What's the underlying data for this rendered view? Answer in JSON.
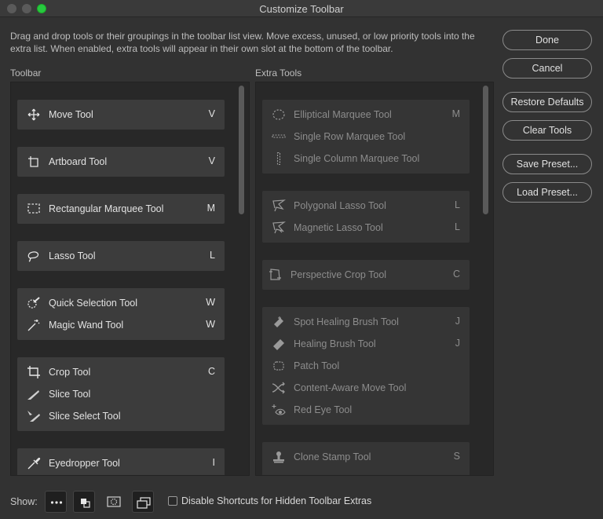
{
  "window": {
    "title": "Customize Toolbar"
  },
  "instructions": "Drag and drop tools or their groupings in the toolbar list view. Move excess, unused, or low priority tools into the extra list. When enabled, extra tools will appear in their own slot at the bottom of the toolbar.",
  "labels": {
    "toolbar": "Toolbar",
    "extra": "Extra Tools"
  },
  "toolbar": {
    "g1": {
      "t1": {
        "name": "Move Tool",
        "key": "V"
      }
    },
    "g2": {
      "t1": {
        "name": "Artboard Tool",
        "key": "V"
      }
    },
    "g3": {
      "t1": {
        "name": "Rectangular Marquee Tool",
        "key": "M"
      }
    },
    "g4": {
      "t1": {
        "name": "Lasso Tool",
        "key": "L"
      }
    },
    "g5": {
      "t1": {
        "name": "Quick Selection Tool",
        "key": "W"
      },
      "t2": {
        "name": "Magic Wand Tool",
        "key": "W"
      }
    },
    "g6": {
      "t1": {
        "name": "Crop Tool",
        "key": "C"
      },
      "t2": {
        "name": "Slice Tool",
        "key": ""
      },
      "t3": {
        "name": "Slice Select Tool",
        "key": ""
      }
    },
    "g7": {
      "t1": {
        "name": "Eyedropper Tool",
        "key": "I"
      }
    }
  },
  "extra": {
    "g1": {
      "t1": {
        "name": "Elliptical Marquee Tool",
        "key": "M"
      },
      "t2": {
        "name": "Single Row Marquee Tool",
        "key": ""
      },
      "t3": {
        "name": "Single Column Marquee Tool",
        "key": ""
      }
    },
    "g2": {
      "t1": {
        "name": "Polygonal Lasso Tool",
        "key": "L"
      },
      "t2": {
        "name": "Magnetic Lasso Tool",
        "key": "L"
      }
    },
    "g3": {
      "t1": {
        "name": "Perspective Crop Tool",
        "key": "C"
      }
    },
    "g4": {
      "t1": {
        "name": "Spot Healing Brush Tool",
        "key": "J"
      },
      "t2": {
        "name": "Healing Brush Tool",
        "key": "J"
      },
      "t3": {
        "name": "Patch Tool",
        "key": ""
      },
      "t4": {
        "name": "Content-Aware Move Tool",
        "key": ""
      },
      "t5": {
        "name": "Red Eye Tool",
        "key": ""
      }
    },
    "g5": {
      "t1": {
        "name": "Clone Stamp Tool",
        "key": "S"
      }
    }
  },
  "buttons": {
    "done": "Done",
    "cancel": "Cancel",
    "restore": "Restore Defaults",
    "clear": "Clear Tools",
    "save": "Save Preset...",
    "load": "Load Preset..."
  },
  "bottom": {
    "show": "Show:",
    "disable_shortcuts": "Disable Shortcuts for Hidden Toolbar Extras",
    "disable_checked": false
  },
  "icons": [
    "move-icon",
    "artboard-icon",
    "rect-marquee-icon",
    "lasso-icon",
    "quick-selection-icon",
    "magic-wand-icon",
    "crop-icon",
    "slice-icon",
    "slice-select-icon",
    "eyedropper-icon",
    "ellipse-marquee-icon",
    "single-row-icon",
    "single-column-icon",
    "polygonal-lasso-icon",
    "magnetic-lasso-icon",
    "perspective-crop-icon",
    "spot-healing-icon",
    "healing-brush-icon",
    "patch-icon",
    "content-aware-move-icon",
    "red-eye-icon",
    "clone-stamp-icon",
    "more-icon",
    "swatch-icon",
    "quick-mask-icon",
    "screen-mode-icon"
  ]
}
